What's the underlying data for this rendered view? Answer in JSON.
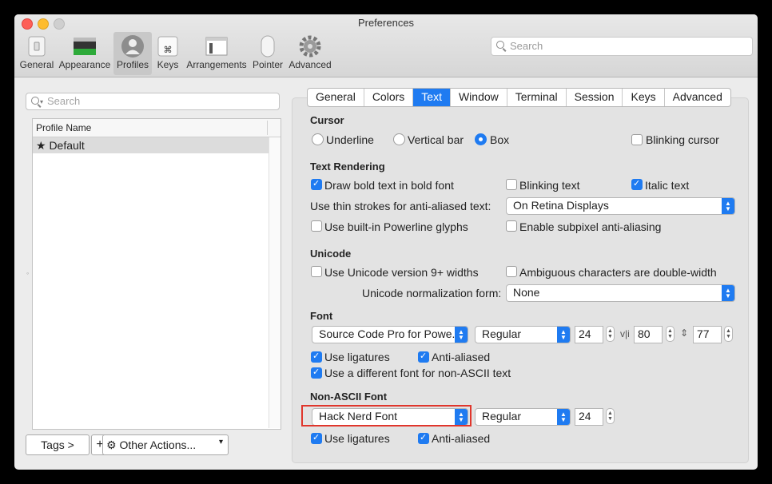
{
  "window": {
    "title": "Preferences"
  },
  "toolbar": {
    "items": [
      {
        "label": "General",
        "icon": "general-switch-icon"
      },
      {
        "label": "Appearance",
        "icon": "appearance-terminal-icon"
      },
      {
        "label": "Profiles",
        "icon": "profiles-person-icon"
      },
      {
        "label": "Keys",
        "icon": "keys-command-icon"
      },
      {
        "label": "Arrangements",
        "icon": "arrangements-window-icon"
      },
      {
        "label": "Pointer",
        "icon": "pointer-mouse-icon"
      },
      {
        "label": "Advanced",
        "icon": "advanced-gear-icon"
      }
    ],
    "search_placeholder": "Search"
  },
  "sidebar": {
    "search_placeholder": "Search",
    "column_header": "Profile Name",
    "profiles": [
      {
        "name": "★ Default",
        "selected": true
      }
    ],
    "bottom": {
      "tags_label": "Tags >",
      "add_label": "+",
      "remove_label": "—",
      "other_actions_label": "⚙ Other Actions..."
    }
  },
  "tabs": [
    "General",
    "Colors",
    "Text",
    "Window",
    "Terminal",
    "Session",
    "Keys",
    "Advanced"
  ],
  "active_tab": "Text",
  "cursor": {
    "heading": "Cursor",
    "underline": "Underline",
    "vertical_bar": "Vertical bar",
    "box": "Box",
    "blinking": "Blinking cursor"
  },
  "text_rendering": {
    "heading": "Text Rendering",
    "bold": "Draw bold text in bold font",
    "blinking_text": "Blinking text",
    "italic": "Italic text",
    "thin_strokes_label": "Use thin strokes for anti-aliased text:",
    "thin_strokes_value": "On Retina Displays",
    "powerline": "Use built-in Powerline glyphs",
    "subpixel": "Enable subpixel anti-aliasing"
  },
  "unicode": {
    "heading": "Unicode",
    "version9": "Use Unicode version 9+ widths",
    "ambiguous": "Ambiguous characters are double-width",
    "normalization_label": "Unicode normalization form:",
    "normalization_value": "None"
  },
  "font": {
    "heading": "Font",
    "family": "Source Code Pro for Powe...",
    "style": "Regular",
    "size": "24",
    "h_spacing": "80",
    "v_spacing": "77",
    "h_spacing_icon": "v|i",
    "v_spacing_icon": "⇕",
    "ligatures": "Use ligatures",
    "antialiased": "Anti-aliased",
    "non_ascii_toggle": "Use a different font for non-ASCII text"
  },
  "non_ascii_font": {
    "heading": "Non-ASCII Font",
    "family": "Hack Nerd Font",
    "style": "Regular",
    "size": "24",
    "ligatures": "Use ligatures",
    "antialiased": "Anti-aliased"
  },
  "colors": {
    "accent": "#1f7bf1",
    "highlight": "#e0362c"
  }
}
